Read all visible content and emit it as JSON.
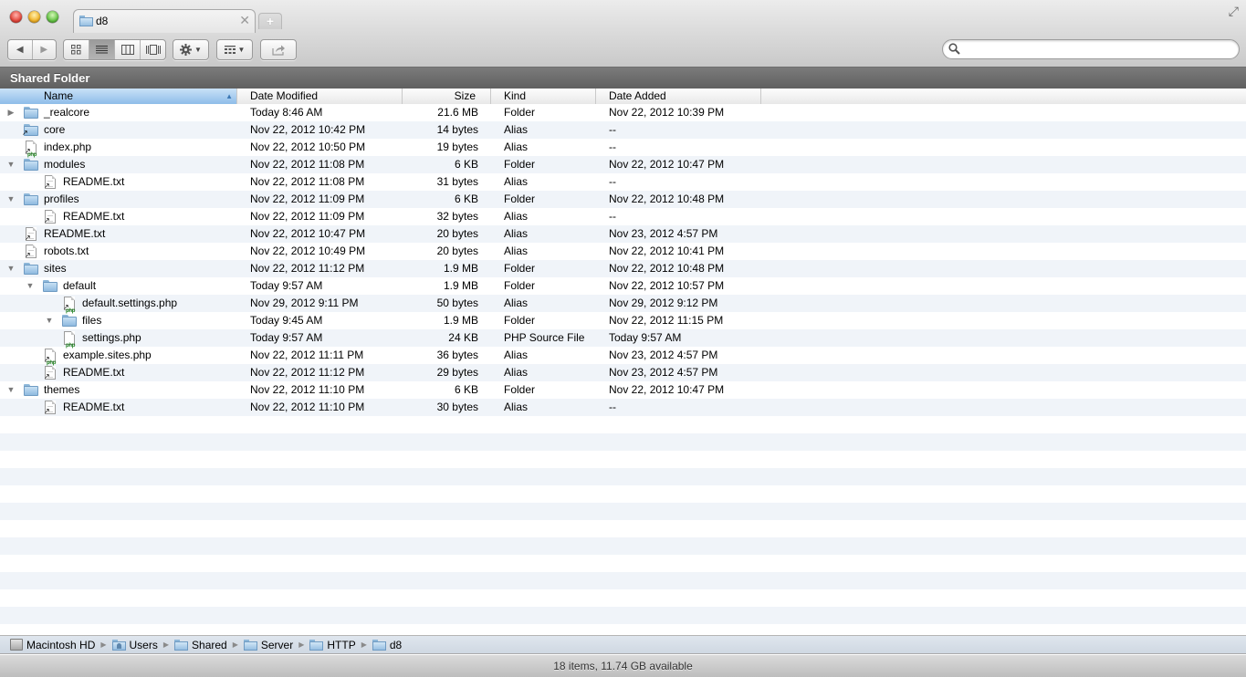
{
  "window": {
    "tab_title": "d8",
    "tab_close_glyph": "✕",
    "new_tab_glyph": "+",
    "fullscreen_glyph": "⤢"
  },
  "toolbar": {
    "back_glyph": "◀",
    "forward_glyph": "▶",
    "view_modes": [
      {
        "name": "icon-view",
        "active": false
      },
      {
        "name": "list-view",
        "active": true
      },
      {
        "name": "column-view",
        "active": false
      },
      {
        "name": "cover-flow-view",
        "active": false
      }
    ],
    "action_caret": "▼",
    "arrange_caret": "▼"
  },
  "search": {
    "value": "",
    "placeholder": ""
  },
  "section_header": {
    "title": "Shared Folder"
  },
  "columns": {
    "name": "Name",
    "date_modified": "Date Modified",
    "size": "Size",
    "kind": "Kind",
    "date_added": "Date Added",
    "sort_glyph": "▲"
  },
  "files": [
    {
      "name": "_realcore",
      "level": 0,
      "type": "folder",
      "disclosure": "collapsed",
      "modified": "Today 8:46 AM",
      "size": "21.6 MB",
      "kind": "Folder",
      "added": "Nov 22, 2012 10:39 PM"
    },
    {
      "name": "core",
      "level": 0,
      "type": "folder-alias",
      "disclosure": "none",
      "modified": "Nov 22, 2012 10:42 PM",
      "size": "14 bytes",
      "kind": "Alias",
      "added": "--"
    },
    {
      "name": "index.php",
      "level": 0,
      "type": "php-alias",
      "disclosure": "none",
      "modified": "Nov 22, 2012 10:50 PM",
      "size": "19 bytes",
      "kind": "Alias",
      "added": "--"
    },
    {
      "name": "modules",
      "level": 0,
      "type": "folder",
      "disclosure": "expanded",
      "modified": "Nov 22, 2012 11:08 PM",
      "size": "6 KB",
      "kind": "Folder",
      "added": "Nov 22, 2012 10:47 PM"
    },
    {
      "name": "README.txt",
      "level": 1,
      "type": "doc-alias",
      "disclosure": "none",
      "modified": "Nov 22, 2012 11:08 PM",
      "size": "31 bytes",
      "kind": "Alias",
      "added": "--"
    },
    {
      "name": "profiles",
      "level": 0,
      "type": "folder",
      "disclosure": "expanded",
      "modified": "Nov 22, 2012 11:09 PM",
      "size": "6 KB",
      "kind": "Folder",
      "added": "Nov 22, 2012 10:48 PM"
    },
    {
      "name": "README.txt",
      "level": 1,
      "type": "doc-alias",
      "disclosure": "none",
      "modified": "Nov 22, 2012 11:09 PM",
      "size": "32 bytes",
      "kind": "Alias",
      "added": "--"
    },
    {
      "name": "README.txt",
      "level": 0,
      "type": "doc-alias",
      "disclosure": "none",
      "modified": "Nov 22, 2012 10:47 PM",
      "size": "20 bytes",
      "kind": "Alias",
      "added": "Nov 23, 2012 4:57 PM"
    },
    {
      "name": "robots.txt",
      "level": 0,
      "type": "doc-alias",
      "disclosure": "none",
      "modified": "Nov 22, 2012 10:49 PM",
      "size": "20 bytes",
      "kind": "Alias",
      "added": "Nov 22, 2012 10:41 PM"
    },
    {
      "name": "sites",
      "level": 0,
      "type": "folder",
      "disclosure": "expanded",
      "modified": "Nov 22, 2012 11:12 PM",
      "size": "1.9 MB",
      "kind": "Folder",
      "added": "Nov 22, 2012 10:48 PM"
    },
    {
      "name": "default",
      "level": 1,
      "type": "folder",
      "disclosure": "expanded",
      "modified": "Today 9:57 AM",
      "size": "1.9 MB",
      "kind": "Folder",
      "added": "Nov 22, 2012 10:57 PM"
    },
    {
      "name": "default.settings.php",
      "level": 2,
      "type": "php-alias",
      "disclosure": "none",
      "modified": "Nov 29, 2012 9:11 PM",
      "size": "50 bytes",
      "kind": "Alias",
      "added": "Nov 29, 2012 9:12 PM"
    },
    {
      "name": "files",
      "level": 2,
      "type": "folder",
      "disclosure": "expanded",
      "modified": "Today 9:45 AM",
      "size": "1.9 MB",
      "kind": "Folder",
      "added": "Nov 22, 2012 11:15 PM"
    },
    {
      "name": "settings.php",
      "level": 2,
      "type": "php",
      "disclosure": "none",
      "modified": "Today 9:57 AM",
      "size": "24 KB",
      "kind": "PHP Source File",
      "added": "Today 9:57 AM"
    },
    {
      "name": "example.sites.php",
      "level": 1,
      "type": "php-alias",
      "disclosure": "none",
      "modified": "Nov 22, 2012 11:11 PM",
      "size": "36 bytes",
      "kind": "Alias",
      "added": "Nov 23, 2012 4:57 PM"
    },
    {
      "name": "README.txt",
      "level": 1,
      "type": "doc-alias",
      "disclosure": "none",
      "modified": "Nov 22, 2012 11:12 PM",
      "size": "29 bytes",
      "kind": "Alias",
      "added": "Nov 23, 2012 4:57 PM"
    },
    {
      "name": "themes",
      "level": 0,
      "type": "folder",
      "disclosure": "expanded",
      "modified": "Nov 22, 2012 11:10 PM",
      "size": "6 KB",
      "kind": "Folder",
      "added": "Nov 22, 2012 10:47 PM"
    },
    {
      "name": "README.txt",
      "level": 1,
      "type": "doc-alias",
      "disclosure": "none",
      "modified": "Nov 22, 2012 11:10 PM",
      "size": "30 bytes",
      "kind": "Alias",
      "added": "--"
    }
  ],
  "glyphs": {
    "collapsed": "▶",
    "expanded": "▼",
    "alias_arrow": "↗",
    "php_label": "php",
    "crumb_separator": "▶"
  },
  "pathbar": {
    "items": [
      {
        "label": "Macintosh HD",
        "icon": "hard-drive"
      },
      {
        "label": "Users",
        "icon": "users-folder"
      },
      {
        "label": "Shared",
        "icon": "folder"
      },
      {
        "label": "Server",
        "icon": "folder"
      },
      {
        "label": "HTTP",
        "icon": "folder"
      },
      {
        "label": "d8",
        "icon": "folder"
      }
    ]
  },
  "status": {
    "text": "18 items, 11.74 GB available"
  }
}
